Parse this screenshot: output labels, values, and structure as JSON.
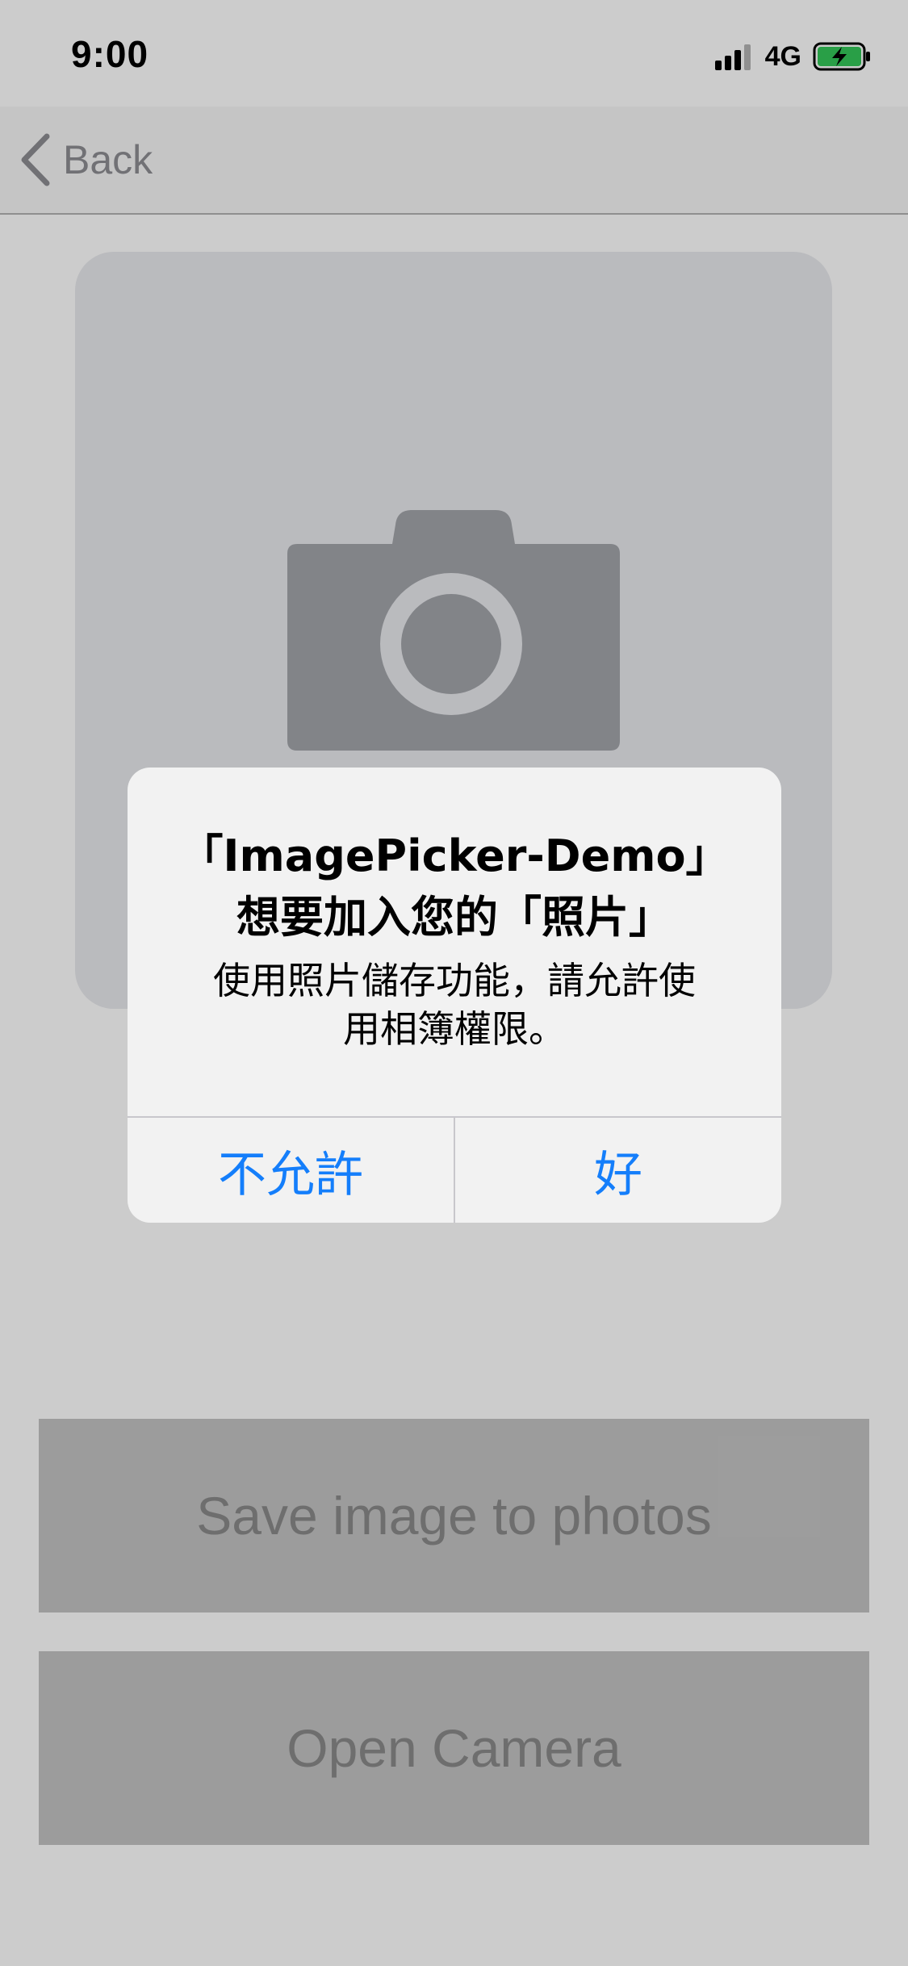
{
  "status_bar": {
    "time": "9:00",
    "network": "4G",
    "icons": [
      "signal-bars-icon",
      "battery-charging-icon"
    ],
    "battery_color": "#34c759"
  },
  "nav": {
    "back_label": "Back",
    "back_icon": "chevron-left-icon"
  },
  "content": {
    "placeholder_icon": "camera-icon",
    "save_button_label": "Save image to photos",
    "camera_button_label": "Open Camera"
  },
  "alert": {
    "title_line1": "「ImagePicker-Demo」",
    "title_line2": "想要加入您的「照片」",
    "message_line1": "使用照片儲存功能，請允許使",
    "message_line2": "用相簿權限。",
    "deny_label": "不允許",
    "allow_label": "好"
  },
  "colors": {
    "accent": "#147efb",
    "alert_background": "#f2f2f2",
    "button_background": "#c4c4c4",
    "placeholder_background": "#e9eaee"
  }
}
